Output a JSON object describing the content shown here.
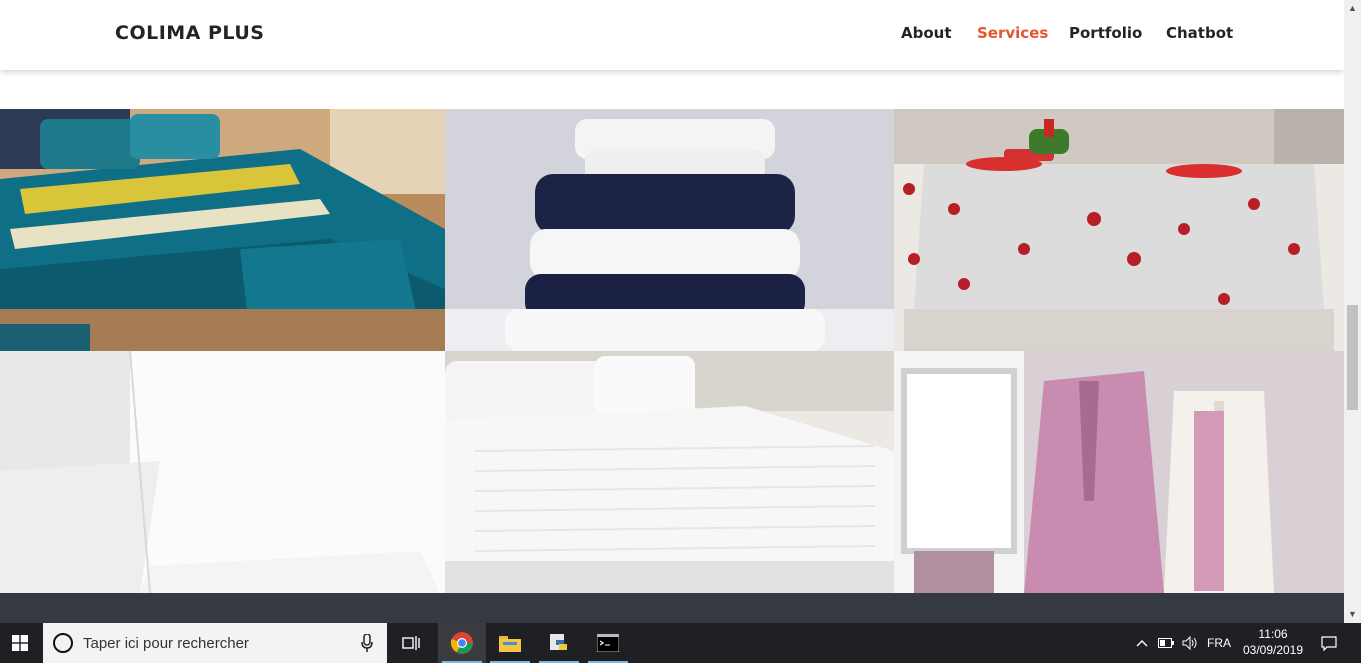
{
  "navbar": {
    "brand": "COLIMA PLUS",
    "links": [
      {
        "label": "About",
        "active": false
      },
      {
        "label": "Services",
        "active": true
      },
      {
        "label": "Portfolio",
        "active": false
      },
      {
        "label": "Chatbot",
        "active": false
      }
    ]
  },
  "colors": {
    "accent": "#e4572e",
    "text": "#212529",
    "footer": "#343a40",
    "taskbar": "#1f2023"
  },
  "gallery": {
    "tiles": [
      {
        "subject": "teal-patterned-bedding"
      },
      {
        "subject": "stacked-towels"
      },
      {
        "subject": "heart-print-tablecloth"
      },
      {
        "subject": "white-pillows"
      },
      {
        "subject": "white-striped-bed"
      },
      {
        "subject": "bathrobes"
      }
    ]
  },
  "taskbar": {
    "search_placeholder": "Taper ici pour rechercher",
    "language": "FRA",
    "time": "11:06",
    "date": "03/09/2019",
    "icons": [
      "windows-start-icon",
      "cortana-icon",
      "mic-icon",
      "task-view-icon",
      "chrome-icon",
      "file-explorer-icon",
      "python-icon",
      "terminal-icon",
      "chevron-up-icon",
      "battery-icon",
      "volume-icon",
      "notification-icon"
    ]
  }
}
